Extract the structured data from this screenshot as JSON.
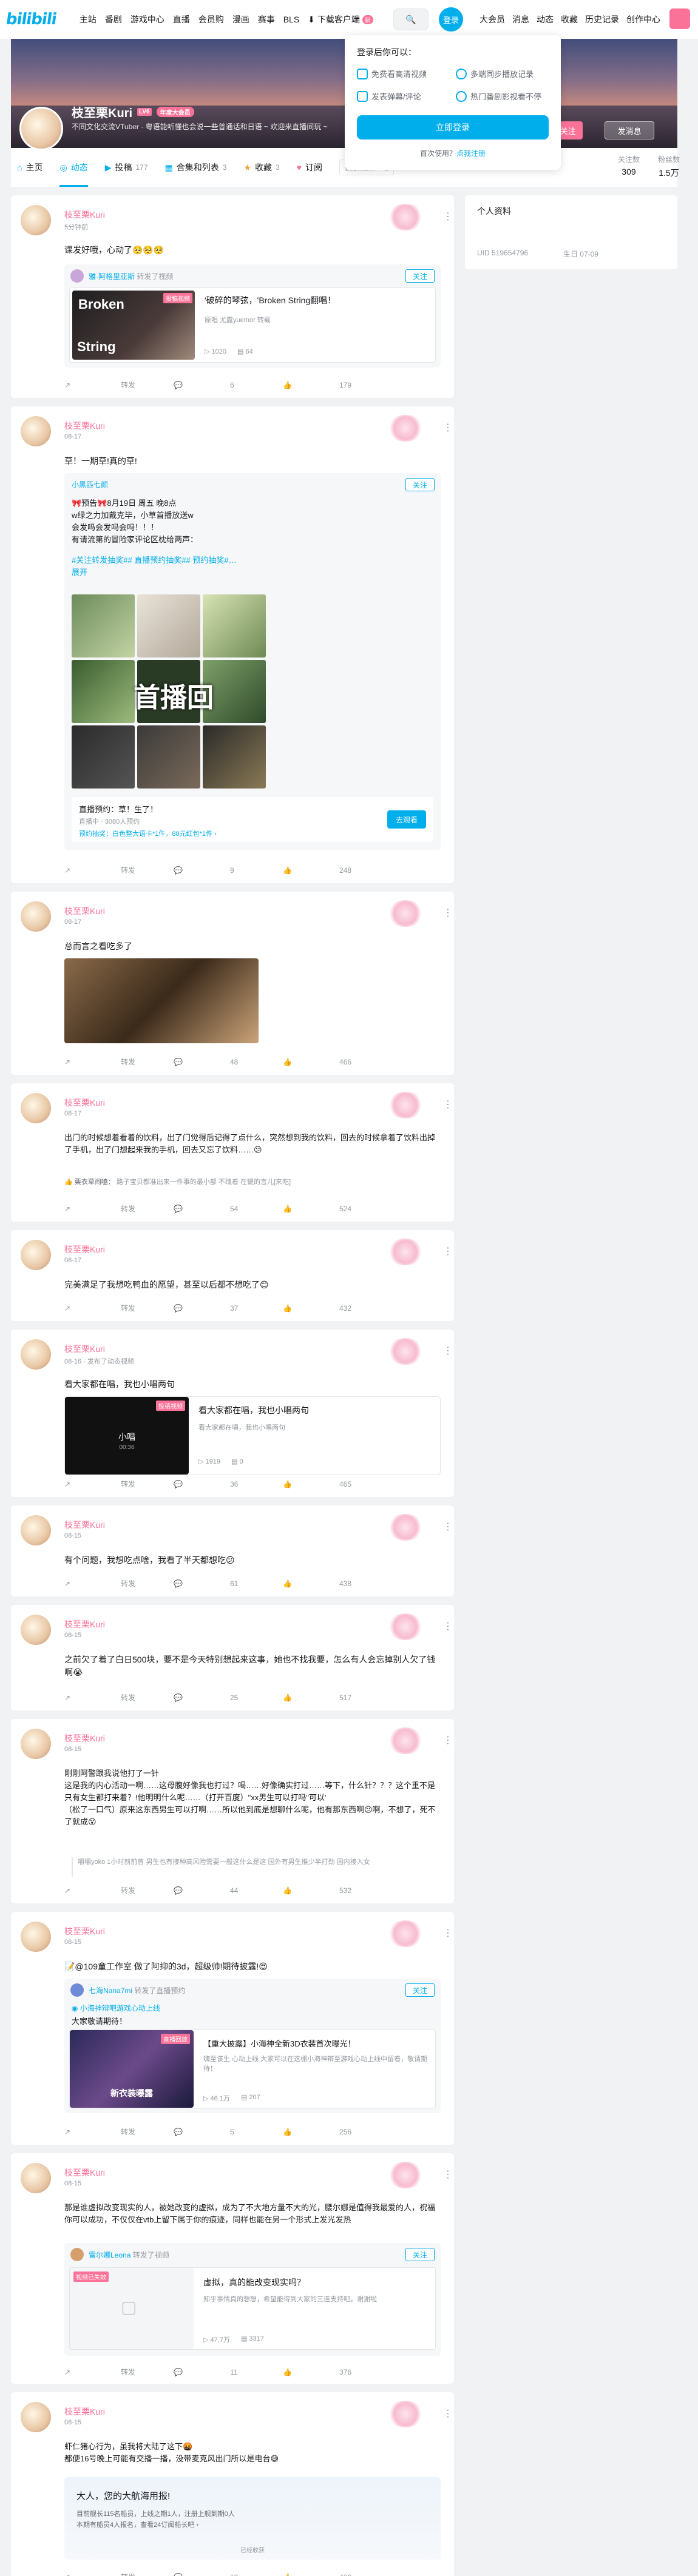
{
  "nav": {
    "logo": "bilibili",
    "left": [
      "主站",
      "番剧",
      "游戏中心",
      "直播",
      "会员购",
      "漫画",
      "赛事",
      "BLS"
    ],
    "download": "下载客户端",
    "download_badge": "新",
    "login": "登录",
    "right": [
      "大会员",
      "消息",
      "动态",
      "收藏",
      "历史记录",
      "创作中心"
    ]
  },
  "login_popup": {
    "title": "登录后你可以：",
    "items": [
      "免费看高清视频",
      "多端同步播放记录",
      "发表弹幕/评论",
      "热门番剧影视看不停"
    ],
    "button": "立即登录",
    "reg_prefix": "首次使用？",
    "reg_link": "点我注册"
  },
  "profile": {
    "name": "枝至栗Kuri",
    "level": "LV6",
    "vip": "年度大会员",
    "sign": "不同文化交流VTuber · 粤语能听懂也会说一些普通话和日语 ~ 欢迎来直播间玩 ~",
    "follow": "+ 关注",
    "message": "发消息"
  },
  "tabs": [
    {
      "label": "主页",
      "count": ""
    },
    {
      "label": "动态",
      "count": ""
    },
    {
      "label": "投稿",
      "count": "177"
    },
    {
      "label": "合集和列表",
      "count": "3"
    },
    {
      "label": "收藏",
      "count": "3"
    },
    {
      "label": "订阅",
      "count": ""
    }
  ],
  "tab_search_placeholder": "搜索视频、动态",
  "stats": [
    {
      "label": "关注数",
      "value": "309"
    },
    {
      "label": "粉丝数",
      "value": "1.5万"
    }
  ],
  "sidebar": {
    "title": "个人资料",
    "uid_label": "UID",
    "uid": "519654796",
    "birthday_label": "生日",
    "birthday": "07-09"
  },
  "actions": {
    "forward": "转发"
  },
  "posts": [
    {
      "time": "5分钟前",
      "text": "课发好哦，心动了🥺🥺🥺",
      "inner_user": "雅·阿格里亚斯",
      "inner_action": "转发了视频",
      "follow": "关注",
      "video_title": "'破碎的琴弦，'Broken String翻唱！",
      "video_author": "原唱 尤露yuemor 转载",
      "video_views": "1020",
      "video_danmaku": "64",
      "replies": "6",
      "likes": "179"
    },
    {
      "time": "08-17",
      "text1": "草！一期草!真的草!",
      "inner_user": "小黑匹七颜",
      "follow": "关注",
      "line1": "🎀预告🎀8月19日 周五 晚8点",
      "line2": "w绿之力加戴克毕，小草首播放送w",
      "line3": "会发吗会发吗会吗！！！",
      "line4": "有请流第的冒险家评论区枕给两声：",
      "tags": "#关注转发抽奖## 直播预约抽奖## 预约抽奖#…",
      "expand": "展开",
      "image_text": "首播回",
      "reserve_title": "直播预约：草！生了！",
      "reserve_sub": "直播中 · 3080人预约",
      "reserve_prize": "预约抽奖：白色整大语卡*1件，88元红包*1件 ›",
      "reserve_btn": "去观看",
      "replies": "9",
      "likes": "248"
    },
    {
      "time": "08-17",
      "text": "总而言之看吃多了",
      "replies": "48",
      "likes": "466"
    },
    {
      "time": "08-17",
      "text": "出门的时候想着看着的饮料，出了门觉得后记得了点什么，突然想到我的饮料，回去的时候拿着了饮料出掉了手机，出了门想起来我的手机，回去又忘了饮料……😕",
      "quote_user": "栗衣草闹嗑：",
      "quote": "路子宝贝都准出来一件事的最小部 不瑰着 在键的言儿[来吃]",
      "replies": "54",
      "likes": "524"
    },
    {
      "time": "08-17",
      "text": "完美满足了我想吃鸭血的愿望，甚至以后都不想吃了😊",
      "replies": "37",
      "likes": "432"
    },
    {
      "time": "08-16",
      "time_extra": "发布了动态视频",
      "text": "看大家都在唱，我也小唱两句",
      "video_title": "看大家都在唱，我也小唱两句",
      "video_sub": "看大家都在唱，我也小唱两句",
      "video_label": "小唱",
      "video_dur": "00:36",
      "video_views": "1919",
      "video_danmaku": "0",
      "replies": "36",
      "likes": "465"
    },
    {
      "time": "08-15",
      "text": "有个问题，我想吃点啥，我看了半天都想吃😕",
      "replies": "61",
      "likes": "438"
    },
    {
      "time": "08-15",
      "text": "之前欠了着了白日500块，要不是今天特别想起来这事，她也不找我要，怎么有人会忘掉别人欠了钱啊😭",
      "replies": "25",
      "likes": "517"
    },
    {
      "time": "08-15",
      "text1": "刚刚阿警跟我说他打了一针",
      "text2": "这是我的内心活动一啊……这母腹好像我也打过？喝……好像确实打过……等下，什么针？？？这个重不是只有女生都打来着？!他明明什么呢……（打开百度）\"xx男生可以打吗\"可以'",
      "text3": "（松了一口气）原来这东西男生可以打啊……所以他到底是想聊什么呢，他有那东西啊😕啊，不想了，死不了就成😮",
      "quote": "嚼嚼yoko 1小时前前曾 男生也有接种高风险需要一般这什么是这 国外有男生推少半打劲 国内接入女",
      "replies": "44",
      "likes": "532"
    },
    {
      "time": "08-15",
      "text": "📝@109童工作室 做了阿抑的3d，超级帅!期待披露!😍",
      "inner_user": "七海Nana7mi",
      "inner_action": "转发了直播预约",
      "follow": "关注",
      "inner_tag": "小海神辩吧游戏心动上线",
      "inner_text": "大家敬请期待！",
      "video_title": "【重大披露】小海神全新3D衣装首次曝光！",
      "video_desc": "嗨至该生 心动上线 大家可以在这棚小海神辩至游戏心动上线中留着，敬请期待！",
      "video_badge": "直播回放",
      "video_caption": "新衣装曝露",
      "video_views": "46.1万",
      "video_danmaku": "207",
      "replies": "5",
      "likes": "256"
    },
    {
      "time": "08-15",
      "text": "那是谁虚拟改变现实的人，被她改变的虚拟，成为了不大地方量不大的光，腰尔娜是值得我最爱的人，祝福你可以成功，不仅仅在vtb上留下属于你的痕迹，同样也能在另一个形式上发光发热",
      "inner_user": "雷尔娜Leona",
      "inner_action": "转发了视频",
      "follow": "关注",
      "video_badge": "视频已失效",
      "video_title": "虚拟，真的能改变现实吗？",
      "video_desc": "知乎事情真的想想，希望能得到大家的三连支持吧。谢谢啦",
      "video_views": "47.7万",
      "video_danmaku": "3317",
      "replies": "11",
      "likes": "376"
    },
    {
      "time": "08-15",
      "text1": "虾仁猪心行为，虽我将大陆了这下🤬",
      "text2": "都便16号晚上可能有交播一播，没带麦克风出门所以是电台😅",
      "inner_title": "大人，您的大航海用报!",
      "inner_l1": "目前舰长115名船员，上线之期1人，注册上舰到期0人",
      "inner_l2": "本期有船员4人报名，查看24订阅船长吧 ›",
      "inner_foot": "已经收获",
      "replies": "19",
      "likes": "460"
    }
  ]
}
